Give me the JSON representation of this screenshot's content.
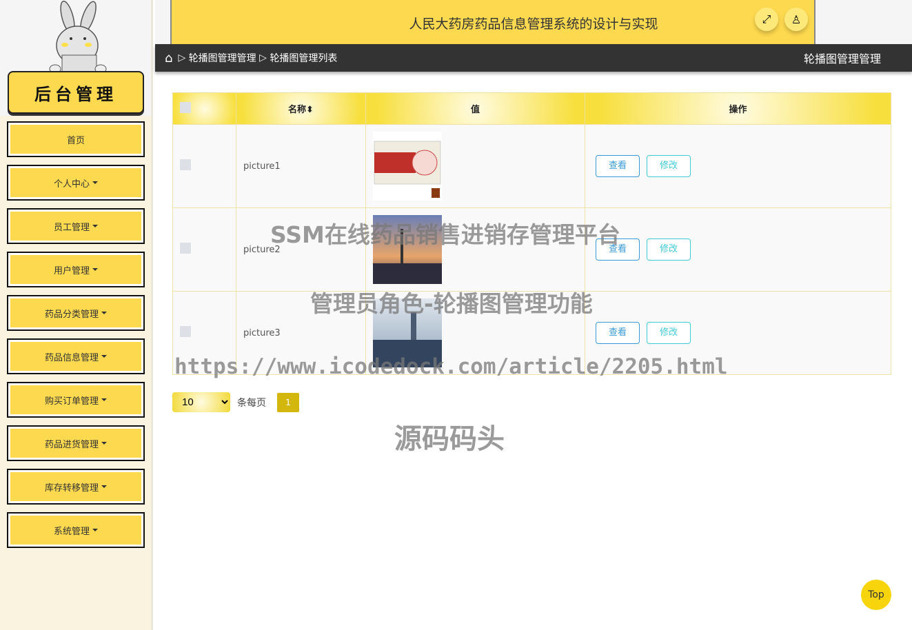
{
  "sidebar": {
    "logo": "后台管理",
    "items": [
      {
        "label": "首页",
        "dropdown": false
      },
      {
        "label": "个人中心",
        "dropdown": true
      },
      {
        "label": "员工管理",
        "dropdown": true
      },
      {
        "label": "用户管理",
        "dropdown": true
      },
      {
        "label": "药品分类管理",
        "dropdown": true
      },
      {
        "label": "药品信息管理",
        "dropdown": true
      },
      {
        "label": "购买订单管理",
        "dropdown": true
      },
      {
        "label": "药品进货管理",
        "dropdown": true
      },
      {
        "label": "库存转移管理",
        "dropdown": true
      },
      {
        "label": "系统管理",
        "dropdown": true
      }
    ]
  },
  "header": {
    "title": "人民大药房药品信息管理系统的设计与实现",
    "icons": [
      "fullscreen-icon",
      "user-icon"
    ]
  },
  "breadcrumb": {
    "items": [
      "轮播图管理管理",
      "轮播图管理列表"
    ],
    "right": "轮播图管理管理"
  },
  "table": {
    "headers": [
      "名称",
      "值",
      "操作"
    ],
    "rows": [
      {
        "name": "picture1",
        "image": "medicine-box"
      },
      {
        "name": "picture2",
        "image": "city-sunset"
      },
      {
        "name": "picture3",
        "image": "city-skyline"
      }
    ],
    "view_label": "查看",
    "edit_label": "修改"
  },
  "pager": {
    "page_size": "10",
    "per_page_label": "条每页",
    "current_page": "1"
  },
  "watermark": [
    "SSM在线药品销售进销存管理平台",
    "管理员角色-轮播图管理功能",
    "https://www.icodedock.com/article/2205.html",
    "源码码头"
  ],
  "top_label": "Top",
  "colors": {
    "accent": "#fdd94f",
    "dark_bar": "#333333",
    "view": "#3a9ad9",
    "edit": "#3fcad8"
  }
}
